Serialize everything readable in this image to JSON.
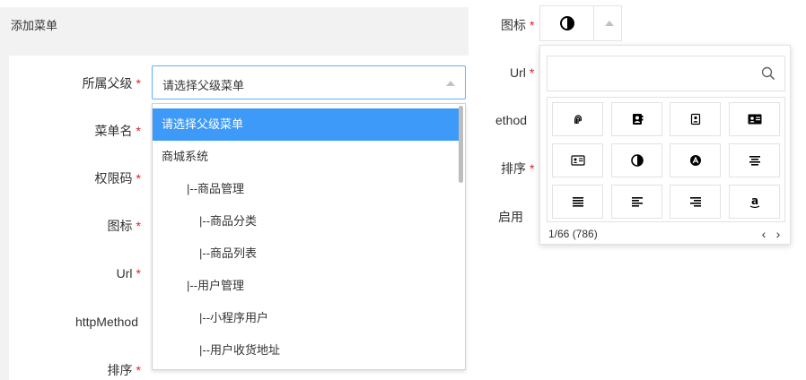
{
  "left_panel": {
    "header_title": "添加菜单",
    "labels": {
      "parent": "所属父级",
      "menu_name": "菜单名",
      "permission": "权限码",
      "icon": "图标",
      "url": "Url",
      "http_method": "httpMethod",
      "sort": "排序"
    },
    "required_mark": "*",
    "parent_select": {
      "value": "请选择父级菜单",
      "options": [
        "请选择父级菜单",
        "商城系统",
        "|--商品管理",
        "|--商品分类",
        "|--商品列表",
        "|--用户管理",
        "|--小程序用户",
        "|--用户收货地址"
      ],
      "selected_index": 0
    }
  },
  "right_panel": {
    "labels": {
      "icon": "图标",
      "url": "Url",
      "method_partial": "ethod",
      "sort": "排序",
      "enabled_partial": "启用"
    },
    "required_mark": "*",
    "icon_picker": {
      "current_icon": "circle-half-icon",
      "search_placeholder": "",
      "icons": [
        "fingerprint-icon",
        "address-book-icon",
        "address-book-o-icon",
        "address-card-icon",
        "address-card-o-icon",
        "adjust-icon",
        "adn-icon",
        "align-center-icon",
        "align-justify-icon",
        "align-left-icon",
        "align-right-icon",
        "amazon-icon"
      ],
      "pager": "1/66 (786)",
      "prev": "‹",
      "next": "›"
    }
  }
}
